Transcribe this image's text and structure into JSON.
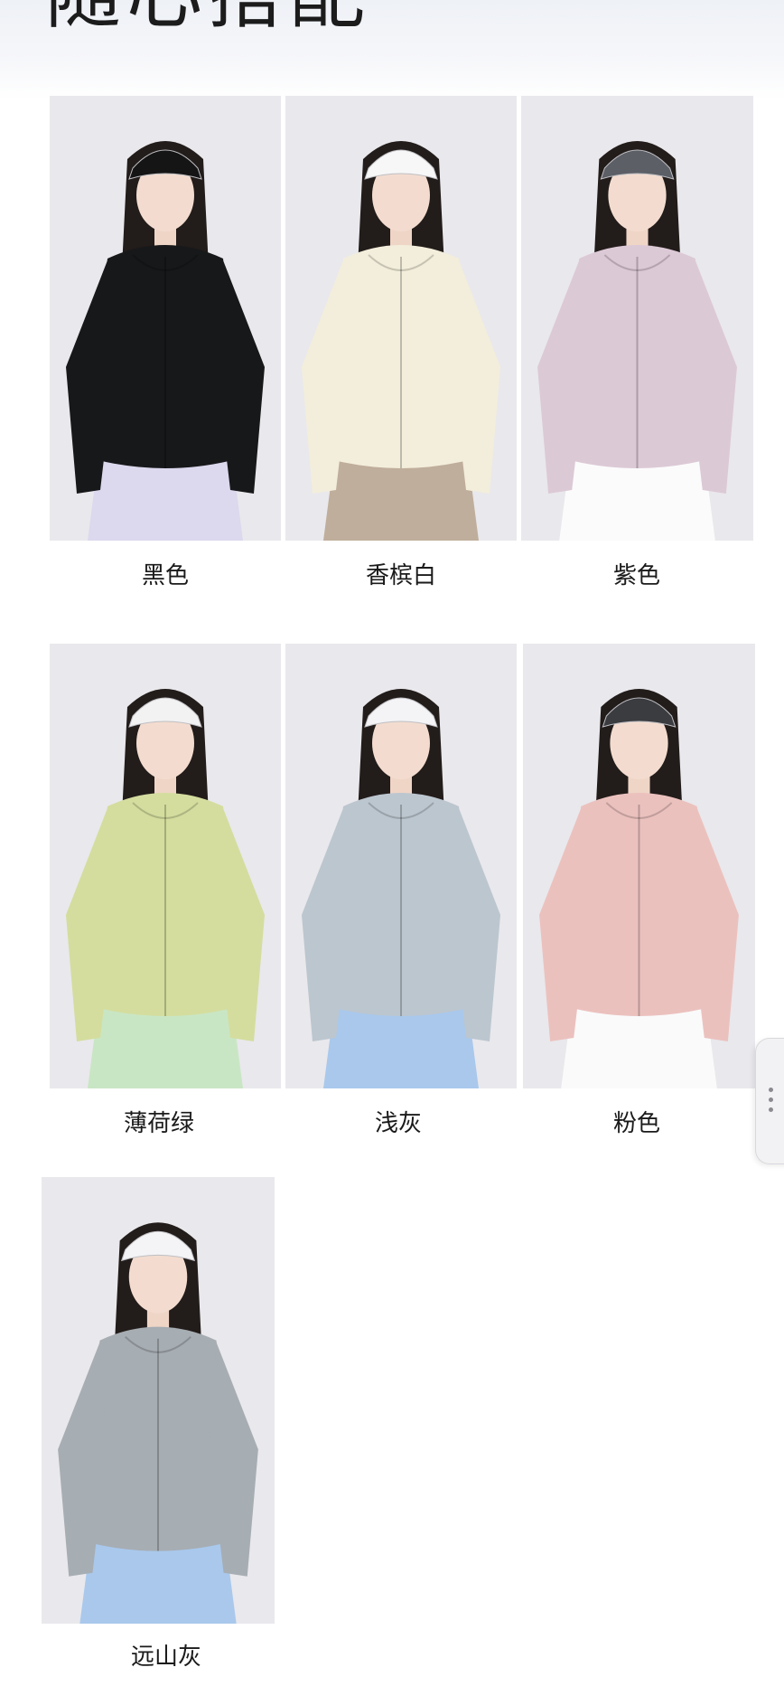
{
  "section": {
    "title": "随心搭配"
  },
  "products": [
    {
      "name": "黑色",
      "jacket": "#17181a",
      "hat": "#151515",
      "bottom": "#dcd8ee"
    },
    {
      "name": "香槟白",
      "jacket": "#f3eedb",
      "hat": "#f7f7f7",
      "bottom": "#bfae9b"
    },
    {
      "name": "紫色",
      "jacket": "#dcc9d6",
      "hat": "#5c5f66",
      "bottom": "#fbfbfb"
    },
    {
      "name": "薄荷绿",
      "jacket": "#d4dd9e",
      "hat": "#f2f2f2",
      "bottom": "#c9e6c4"
    },
    {
      "name": "浅灰",
      "jacket": "#bcc6cf",
      "hat": "#f4f4f6",
      "bottom": "#a9c8ec"
    },
    {
      "name": "粉色",
      "jacket": "#ebc1be",
      "hat": "#3a3c40",
      "bottom": "#fafafa"
    },
    {
      "name": "远山灰",
      "jacket": "#a6adb3",
      "hat": "#f4f4f6",
      "bottom": "#a9c8ec"
    }
  ],
  "colors": {
    "page_bg": "#ffffff",
    "photo_bg": "#e9e8ec",
    "text": "#1a1a1a"
  }
}
